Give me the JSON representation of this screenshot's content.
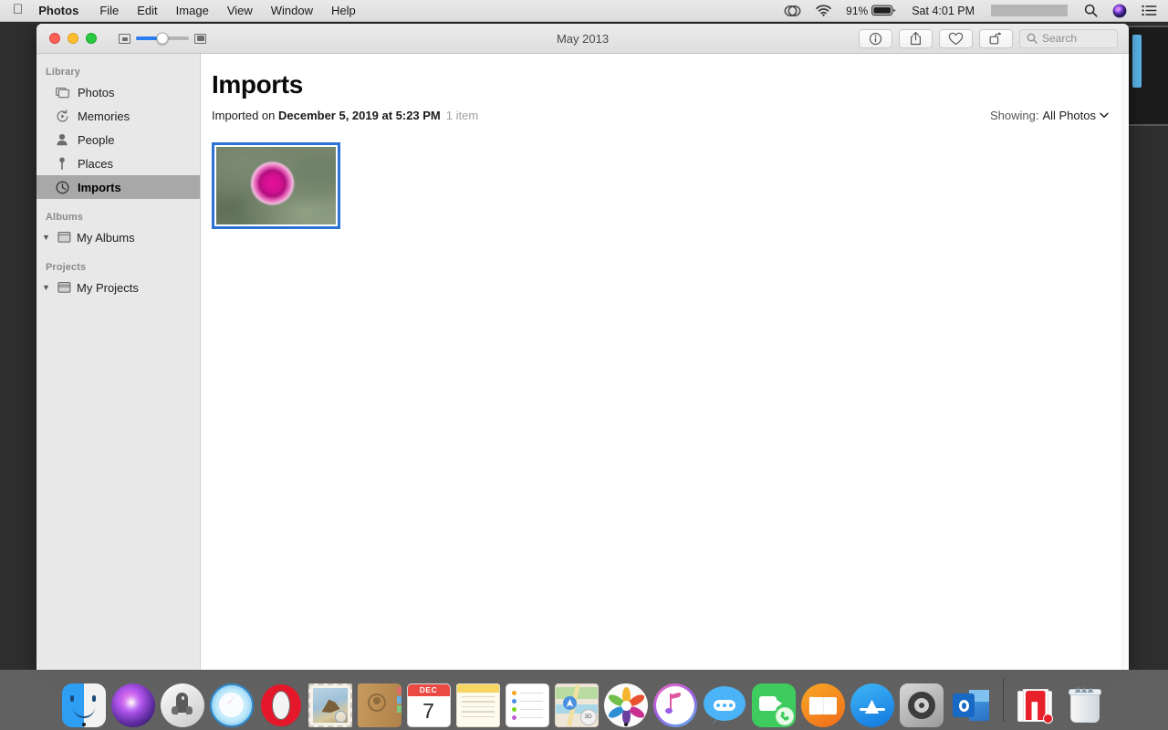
{
  "menubar": {
    "apple_logo": "apple-logo",
    "items": [
      {
        "label": "Photos",
        "bold": true
      },
      {
        "label": "File",
        "bold": false
      },
      {
        "label": "Edit",
        "bold": false
      },
      {
        "label": "Image",
        "bold": false
      },
      {
        "label": "View",
        "bold": false
      },
      {
        "label": "Window",
        "bold": false
      },
      {
        "label": "Help",
        "bold": false
      }
    ],
    "status": {
      "creative_cloud": "creative-cloud-icon",
      "wifi": "wifi-icon",
      "battery_percent": "91%",
      "battery": "battery-icon",
      "clock": "Sat 4:01 PM",
      "redacted": "",
      "search": "spotlight-search-icon",
      "siri": "siri-icon",
      "control_center": "notification-center-icon"
    }
  },
  "window": {
    "title": "May 2013",
    "zoom_slider": {
      "small_icon": "small-thumbnail-icon",
      "large_icon": "large-thumbnail-icon",
      "value": 50
    },
    "toolbar": {
      "info_label": "info-button",
      "share_label": "share-button",
      "favorite_label": "favorite-button",
      "rotate_label": "rotate-button",
      "search_placeholder": "Search"
    }
  },
  "sidebar": {
    "sections": [
      {
        "header": "Library",
        "items": [
          {
            "label": "Photos",
            "icon": "photos-stack-icon",
            "selected": false
          },
          {
            "label": "Memories",
            "icon": "memories-icon",
            "selected": false
          },
          {
            "label": "People",
            "icon": "person-icon",
            "selected": false
          },
          {
            "label": "Places",
            "icon": "map-pin-icon",
            "selected": false
          },
          {
            "label": "Imports",
            "icon": "clock-icon",
            "selected": true
          }
        ]
      },
      {
        "header": "Albums",
        "items": [
          {
            "label": "My Albums",
            "icon": "album-folder-icon",
            "selected": false,
            "disclosure": "▼"
          }
        ]
      },
      {
        "header": "Projects",
        "items": [
          {
            "label": "My Projects",
            "icon": "project-folder-icon",
            "selected": false,
            "disclosure": "▼"
          }
        ]
      }
    ]
  },
  "main": {
    "page_title": "Imports",
    "imported_prefix": "Imported on ",
    "imported_date": "December 5, 2019 at 5:23 PM",
    "item_count": "1 item",
    "showing_label": "Showing:",
    "showing_value": "All Photos",
    "showing_chevron": "chevron-down-icon",
    "photos": [
      {
        "name": "pink-rose-photo",
        "selected": true
      }
    ]
  },
  "dock": {
    "items": [
      {
        "name": "finder",
        "running": true
      },
      {
        "name": "siri",
        "running": false
      },
      {
        "name": "launchpad",
        "running": false
      },
      {
        "name": "safari",
        "running": false
      },
      {
        "name": "opera",
        "running": false
      },
      {
        "name": "mail",
        "running": false
      },
      {
        "name": "contacts",
        "running": false
      },
      {
        "name": "calendar",
        "running": false,
        "badge_month": "DEC",
        "badge_day": "7"
      },
      {
        "name": "notes",
        "running": false
      },
      {
        "name": "reminders",
        "running": false
      },
      {
        "name": "maps",
        "running": false
      },
      {
        "name": "photos",
        "running": true
      },
      {
        "name": "itunes",
        "running": false
      },
      {
        "name": "messages",
        "running": false
      },
      {
        "name": "facetime",
        "running": false
      },
      {
        "name": "books",
        "running": false
      },
      {
        "name": "app-store",
        "running": false
      },
      {
        "name": "system-preferences",
        "running": false
      },
      {
        "name": "outlook",
        "running": false
      },
      {
        "name": "downloads-stack",
        "running": false
      },
      {
        "name": "trash",
        "running": false
      }
    ]
  },
  "colors": {
    "accent_blue": "#2b72d4",
    "selection_gray": "#a8a8a8",
    "sidebar_bg": "#e8e8e8",
    "desktop": "#2e2e2e"
  }
}
